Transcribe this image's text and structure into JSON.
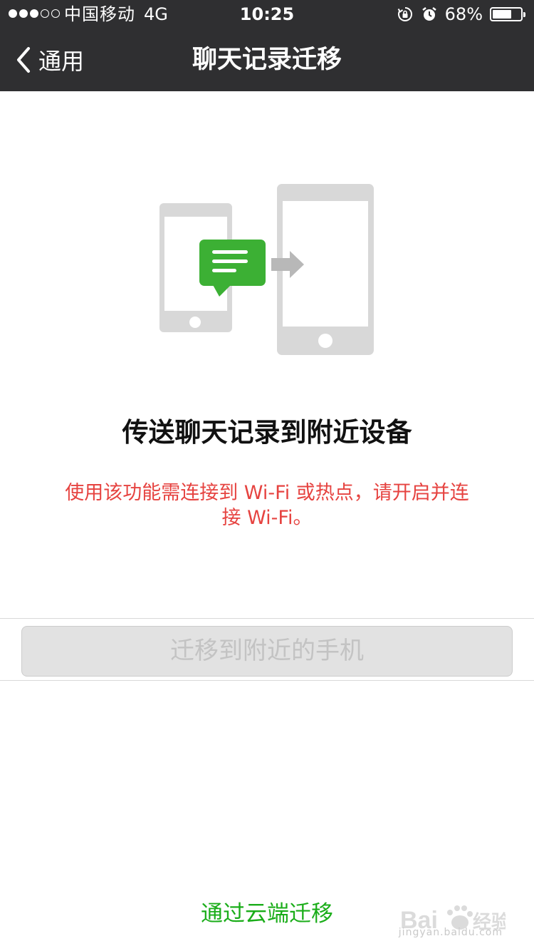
{
  "status_bar": {
    "carrier": "中国移动",
    "network": "4G",
    "time": "10:25",
    "battery_percent": "68%",
    "battery_level": 0.68
  },
  "nav": {
    "back_label": "通用",
    "title": "聊天记录迁移"
  },
  "content": {
    "heading": "传送聊天记录到附近设备",
    "warning_line1": "使用该功能需连接到 Wi-Fi 或热点，请开启并连",
    "warning_line2": "接 Wi-Fi。"
  },
  "migrate_button": {
    "label": "迁移到附近的手机",
    "enabled": false
  },
  "cloud_link": {
    "label": "通过云端迁移"
  },
  "watermark": {
    "brand": "Bai经验",
    "url": "jingyan.baidu.com"
  },
  "colors": {
    "header_bg": "#2f2f31",
    "warning_text": "#e64340",
    "accent_green": "#1aad19",
    "bubble_green": "#3cb034",
    "phone_gray": "#d8d8d8"
  }
}
